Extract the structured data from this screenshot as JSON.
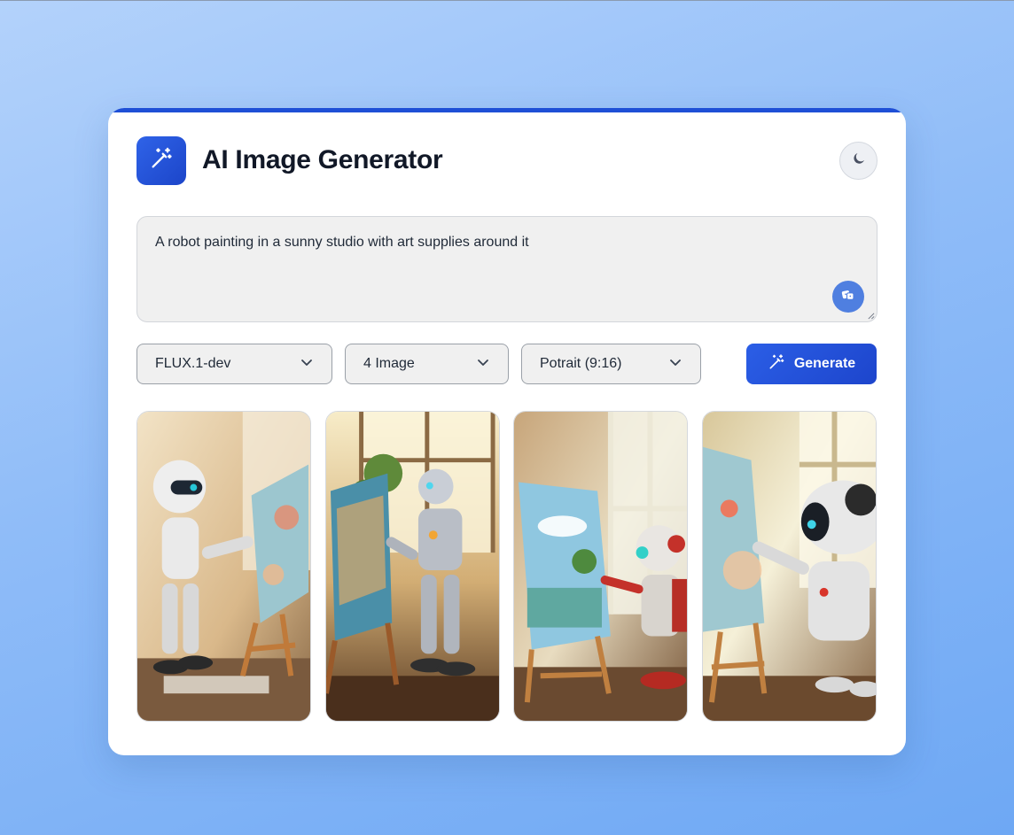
{
  "app": {
    "title": "AI Image Generator"
  },
  "icons": {
    "logo": "magic-wand-icon",
    "theme_toggle": "moon-icon",
    "prompt_action": "dice-icon",
    "generate": "magic-wand-icon",
    "dropdown": "chevron-down-icon"
  },
  "prompt": {
    "value": "A robot painting in a sunny studio with art supplies around it"
  },
  "controls": {
    "model": {
      "selected": "FLUX.1-dev"
    },
    "count": {
      "selected": "4 Image"
    },
    "ratio": {
      "selected": "Potrait (9:16)"
    },
    "generate_label": "Generate"
  },
  "gallery": [
    {
      "alt": ""
    },
    {
      "alt": ""
    },
    {
      "alt": ""
    },
    {
      "alt": ""
    }
  ],
  "colors": {
    "accent": "#1e4fd6",
    "background_gradient": [
      "#b3d2fb",
      "#6ea8f4"
    ],
    "card": "#ffffff",
    "input_bg": "#f0f0f0"
  }
}
